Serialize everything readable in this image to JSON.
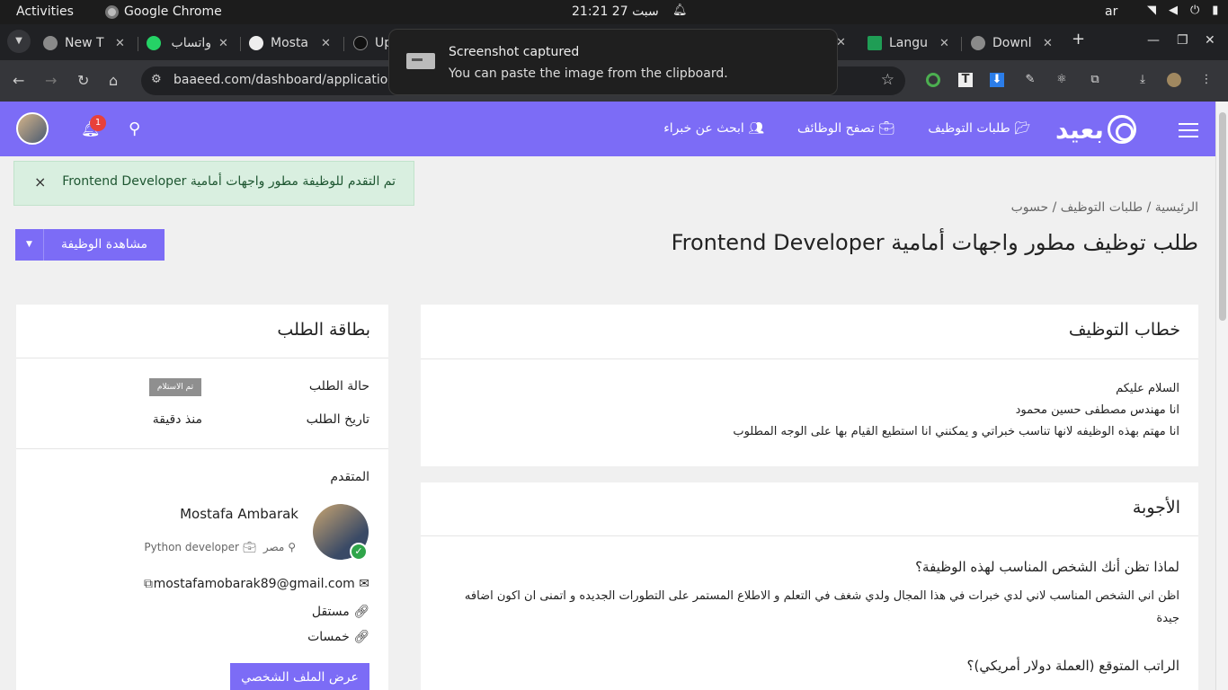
{
  "os": {
    "activities": "Activities",
    "app_name": "Google Chrome",
    "clock": "21:21  27 سبت",
    "lang": "ar"
  },
  "browser": {
    "tabs": [
      {
        "title": "New T",
        "color": "#8a8a8a"
      },
      {
        "title": "واتساب",
        "color": "#25d366"
      },
      {
        "title": "Mosta",
        "color": "#555555"
      },
      {
        "title": "Up",
        "color": "#222222"
      },
      {
        "title": "Langu",
        "color": "#1f9d55"
      },
      {
        "title": "Downl",
        "color": "#8a8a8a"
      }
    ],
    "url": "baaeed.com/dashboard/applications/4",
    "toast": {
      "title": "Screenshot captured",
      "body": "You can paste the image from the clipboard."
    }
  },
  "header": {
    "notification_count": "1",
    "nav": {
      "applications": "طلبات التوظيف",
      "browse_jobs": "تصفح الوظائف",
      "find_experts": "ابحث عن خبراء"
    },
    "logo_text": "بعيد",
    "accent_color": "#7c6cf6"
  },
  "alert": {
    "message": "تم التقدم للوظيفة مطور واجهات أمامية Frontend Developer",
    "close": "×"
  },
  "breadcrumb": {
    "home": "الرئيسية",
    "applications": "طلبات التوظيف",
    "current": "حسوب",
    "separator": "/"
  },
  "page": {
    "title": "طلب توظيف مطور واجهات أمامية Frontend Developer",
    "view_job_button": "مشاهدة الوظيفة"
  },
  "cover_letter": {
    "heading": "خطاب التوظيف",
    "lines": [
      "السلام عليكم",
      "انا مهندس مصطفى حسين محمود",
      "انا مهتم بهذه الوظيفه لانها تناسب خبراتي و يمكنني انا استطيع القيام بها على الوجه المطلوب"
    ]
  },
  "answers": {
    "heading": "الأجوبة",
    "q1": "لماذا تظن أنك الشخص المناسب لهذه الوظيفة؟",
    "a1_line1": "اظن اني الشخص المناسب لاني لدي خبرات في هذا المجال ولدي شغف في التعلم و الاطلاع المستمر على التطورات الجديده و اتمنى ان اكون اضافه",
    "a1_line2": "جيدة",
    "q2": "الراتب المتوقع (العملة دولار أمريكي)؟"
  },
  "application_card": {
    "heading": "بطاقة الطلب",
    "status_label": "حالة الطلب",
    "status_value": "تم الاستلام",
    "date_label": "تاريخ الطلب",
    "date_value": "منذ دقيقة",
    "applicant_label": "المتقدم",
    "applicant_name": "Mostafa Ambarak",
    "country": "مصر",
    "job_title": "Python developer",
    "email": "mostafamobarak89@gmail.com",
    "link1": "مستقل",
    "link2": "خمسات",
    "profile_button": "عرض الملف الشخصي"
  }
}
